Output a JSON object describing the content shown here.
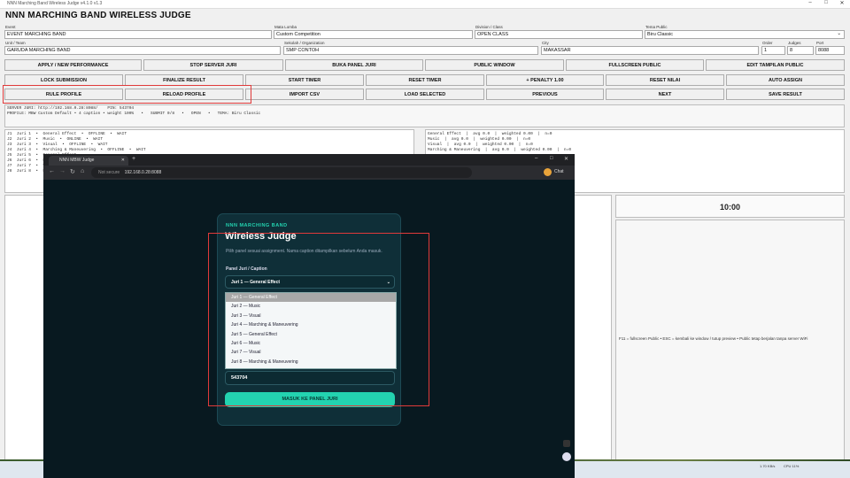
{
  "window": {
    "title": "NNN Marching Band Wireless Judge v4.1.0 v1.3"
  },
  "app": {
    "title": "NNN MARCHING BAND WIRELESS JUDGE"
  },
  "form": {
    "event_label": "Event",
    "event_value": "EVENT MARCHING BAND",
    "mata_label": "Mata Lomba",
    "mata_value": "Custom Competition",
    "division_label": "Division / Class",
    "division_value": "OPEN CLASS",
    "tema_label": "Tema Public",
    "tema_value": "Biru Classic",
    "unit_label": "Unit / Team",
    "unit_value": "GARUDA MARCHING BAND",
    "school_label": "Sekolah / Organization",
    "school_value": "SMP CONTOH",
    "city_label": "City",
    "city_value": "MAKASSAR",
    "order_label": "Order",
    "order_value": "1",
    "judges_label": "Judges",
    "judges_value": "8",
    "port_label": "Port",
    "port_value": "8088"
  },
  "buttons": {
    "r1": [
      "APPLY / NEW PERFORMANCE",
      "STOP SERVER JURI",
      "BUKA PANEL JURI",
      "PUBLIC WINDOW",
      "FULLSCREEN PUBLIC",
      "EDIT TAMPILAN PUBLIC"
    ],
    "r2": [
      "LOCK SUBMISSION",
      "FINALIZE RESULT",
      "START TIMER",
      "RESET TIMER",
      "+ PENALTY 1.00",
      "RESET NILAI",
      "AUTO ASSIGN"
    ],
    "r3": [
      "RULE PROFILE",
      "RELOAD PROFILE",
      "IMPORT CSV",
      "LOAD SELECTED",
      "PREVIOUS",
      "NEXT",
      "SAVE RESULT"
    ]
  },
  "status": {
    "line1": "SERVER JURI: http://192.168.0.28:8088/    PIN: 543704",
    "line2": "PROFILE: MBW Custom Default • 4 caption • weight 100%   •   SUBMIT 0/8   •   OPEN   •   TEMA: Biru Classic"
  },
  "judges_list": [
    "J1  Juri 1  •  General Effect  •  OFFLINE  •  WAIT",
    "J2  Juri 2  •  Music  •  ONLINE  •  WAIT",
    "J3  Juri 3  •  Visual  •  OFFLINE  •  WAIT",
    "J4  Juri 4  •  Marching & Maneuvering  •  OFFLINE  •  WAIT",
    "J5  Juri 5  •  General Effect",
    "J6  Juri 6  •  Music",
    "J7  Juri 7  •  Visual",
    "J8  Juri 8  •  Marching & Maneuvering"
  ],
  "caption_summary": [
    "General Effect  |  avg 0.0  |  weighted 0.00  |  n=0",
    "Music  |  avg 0.0  |  weighted 0.00  |  n=0",
    "Visual  |  avg 0.0  |  weighted 0.00  |  n=0",
    "Marching & Maneuvering  |  avg 0.0  |  weighted 0.00  |  n=0"
  ],
  "timer": "10:00",
  "hint": "F11 = fullscreen Public  •  ESC = kembali ke window / tutup preview  •  Public tetap berjalan tanpa server WiFi",
  "browser": {
    "tab_title": "NNN MBW Judge",
    "security": "Not secure",
    "url": "192.168.0.28:8088",
    "profile": "Chat"
  },
  "judge_page": {
    "brand": "NNN MARCHING BAND",
    "title": "Wireless Judge",
    "subtitle": "Pilih panel sesuai assignment. Nama caption ditampilkan sebelum Anda masuk.",
    "select_label": "Panel Juri / Caption",
    "selected": "Juri 1 — General Effect",
    "options": [
      "Juri 1 — General Effect",
      "Juri 2 — Music",
      "Juri 3 — Visual",
      "Juri 4 — Marching & Maneuvering",
      "Juri 5 — General Effect",
      "Juri 6 — Music",
      "Juri 7 — Visual",
      "Juri 8 — Marching & Maneuvering"
    ],
    "pin_value": "543704",
    "submit_label": "MASUK KE PANEL JURI"
  },
  "tray": {
    "time": "1.70 KB/s",
    "date": "CPU 11%"
  },
  "colors": {
    "accent": "#23d3b0",
    "highlight": "#e03a3a",
    "page_bg": "#081920"
  }
}
